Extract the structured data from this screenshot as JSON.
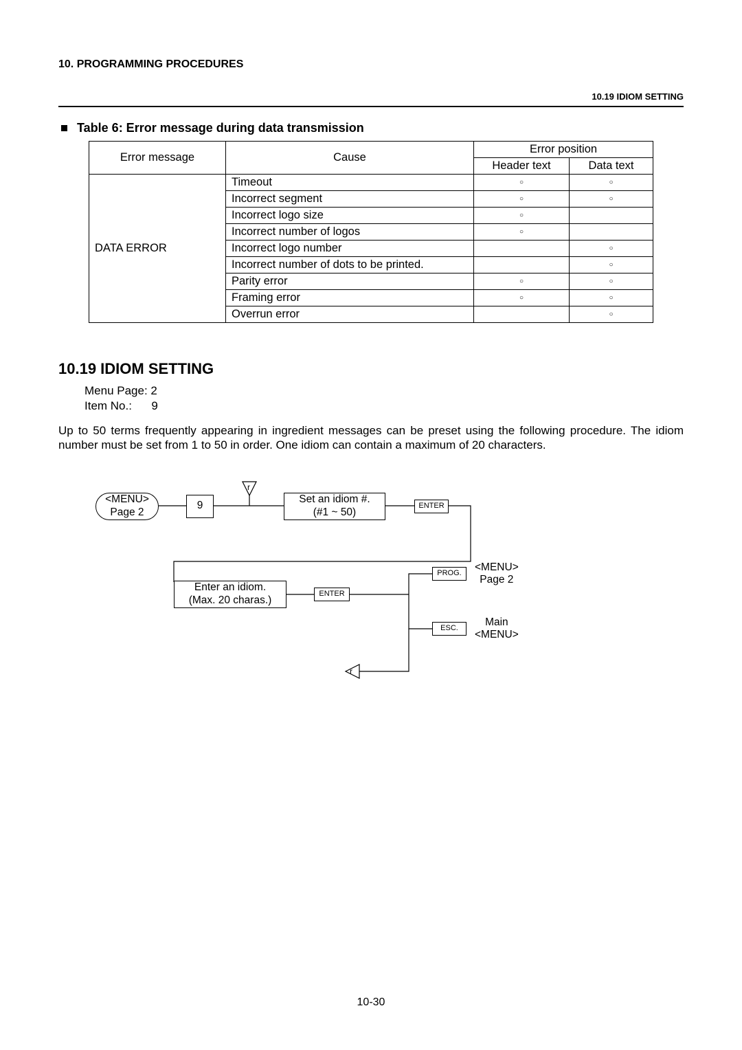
{
  "header": {
    "chapter": "10.   PROGRAMMING PROCEDURES",
    "running_sub": "10.19 IDIOM SETTING"
  },
  "table": {
    "caption": "Table 6:   Error message during data transmission",
    "cols": {
      "msg": "Error message",
      "cause": "Cause",
      "pos": "Error position",
      "ht": "Header text",
      "dt": "Data text"
    },
    "msg_label": "DATA ERROR",
    "mark": "○",
    "rows": [
      {
        "cause": "Timeout",
        "ht": true,
        "dt": true
      },
      {
        "cause": "Incorrect segment",
        "ht": true,
        "dt": true
      },
      {
        "cause": "Incorrect logo size",
        "ht": true,
        "dt": false
      },
      {
        "cause": "Incorrect number of logos",
        "ht": true,
        "dt": false
      },
      {
        "cause": "Incorrect logo number",
        "ht": false,
        "dt": true
      },
      {
        "cause": "Incorrect number of dots to be printed.",
        "ht": false,
        "dt": true
      },
      {
        "cause": "Parity error",
        "ht": true,
        "dt": true
      },
      {
        "cause": "Framing error",
        "ht": true,
        "dt": true
      },
      {
        "cause": "Overrun error",
        "ht": false,
        "dt": true
      }
    ]
  },
  "section": {
    "heading": "10.19  IDIOM SETTING",
    "menu_page_label": "Menu Page:",
    "menu_page_val": "2",
    "item_no_label": "Item No.:",
    "item_no_val": "9",
    "paragraph": "Up to 50 terms frequently appearing in ingredient messages can be preset using the following procedure.   The idiom number must be set from 1 to 50 in order.   One idiom can contain a maximum of 20 characters."
  },
  "flow": {
    "menu_p2_a": "<MENU>",
    "menu_p2_b": "Page 2",
    "nine": "9",
    "set_idiom_a": "Set an idiom #.",
    "set_idiom_b": "(#1 ~ 50)",
    "enter": "ENTER",
    "enter2": "ENTER",
    "enter_idiom_a": "Enter an idiom.",
    "enter_idiom_b": "(Max. 20 charas.)",
    "prog": "PROG.",
    "esc": "ESC.",
    "menu2_a": "<MENU>",
    "menu2_b": "Page 2",
    "main_a": "Main",
    "main_b": "<MENU>",
    "ref": "r"
  },
  "page_number": "10-30"
}
